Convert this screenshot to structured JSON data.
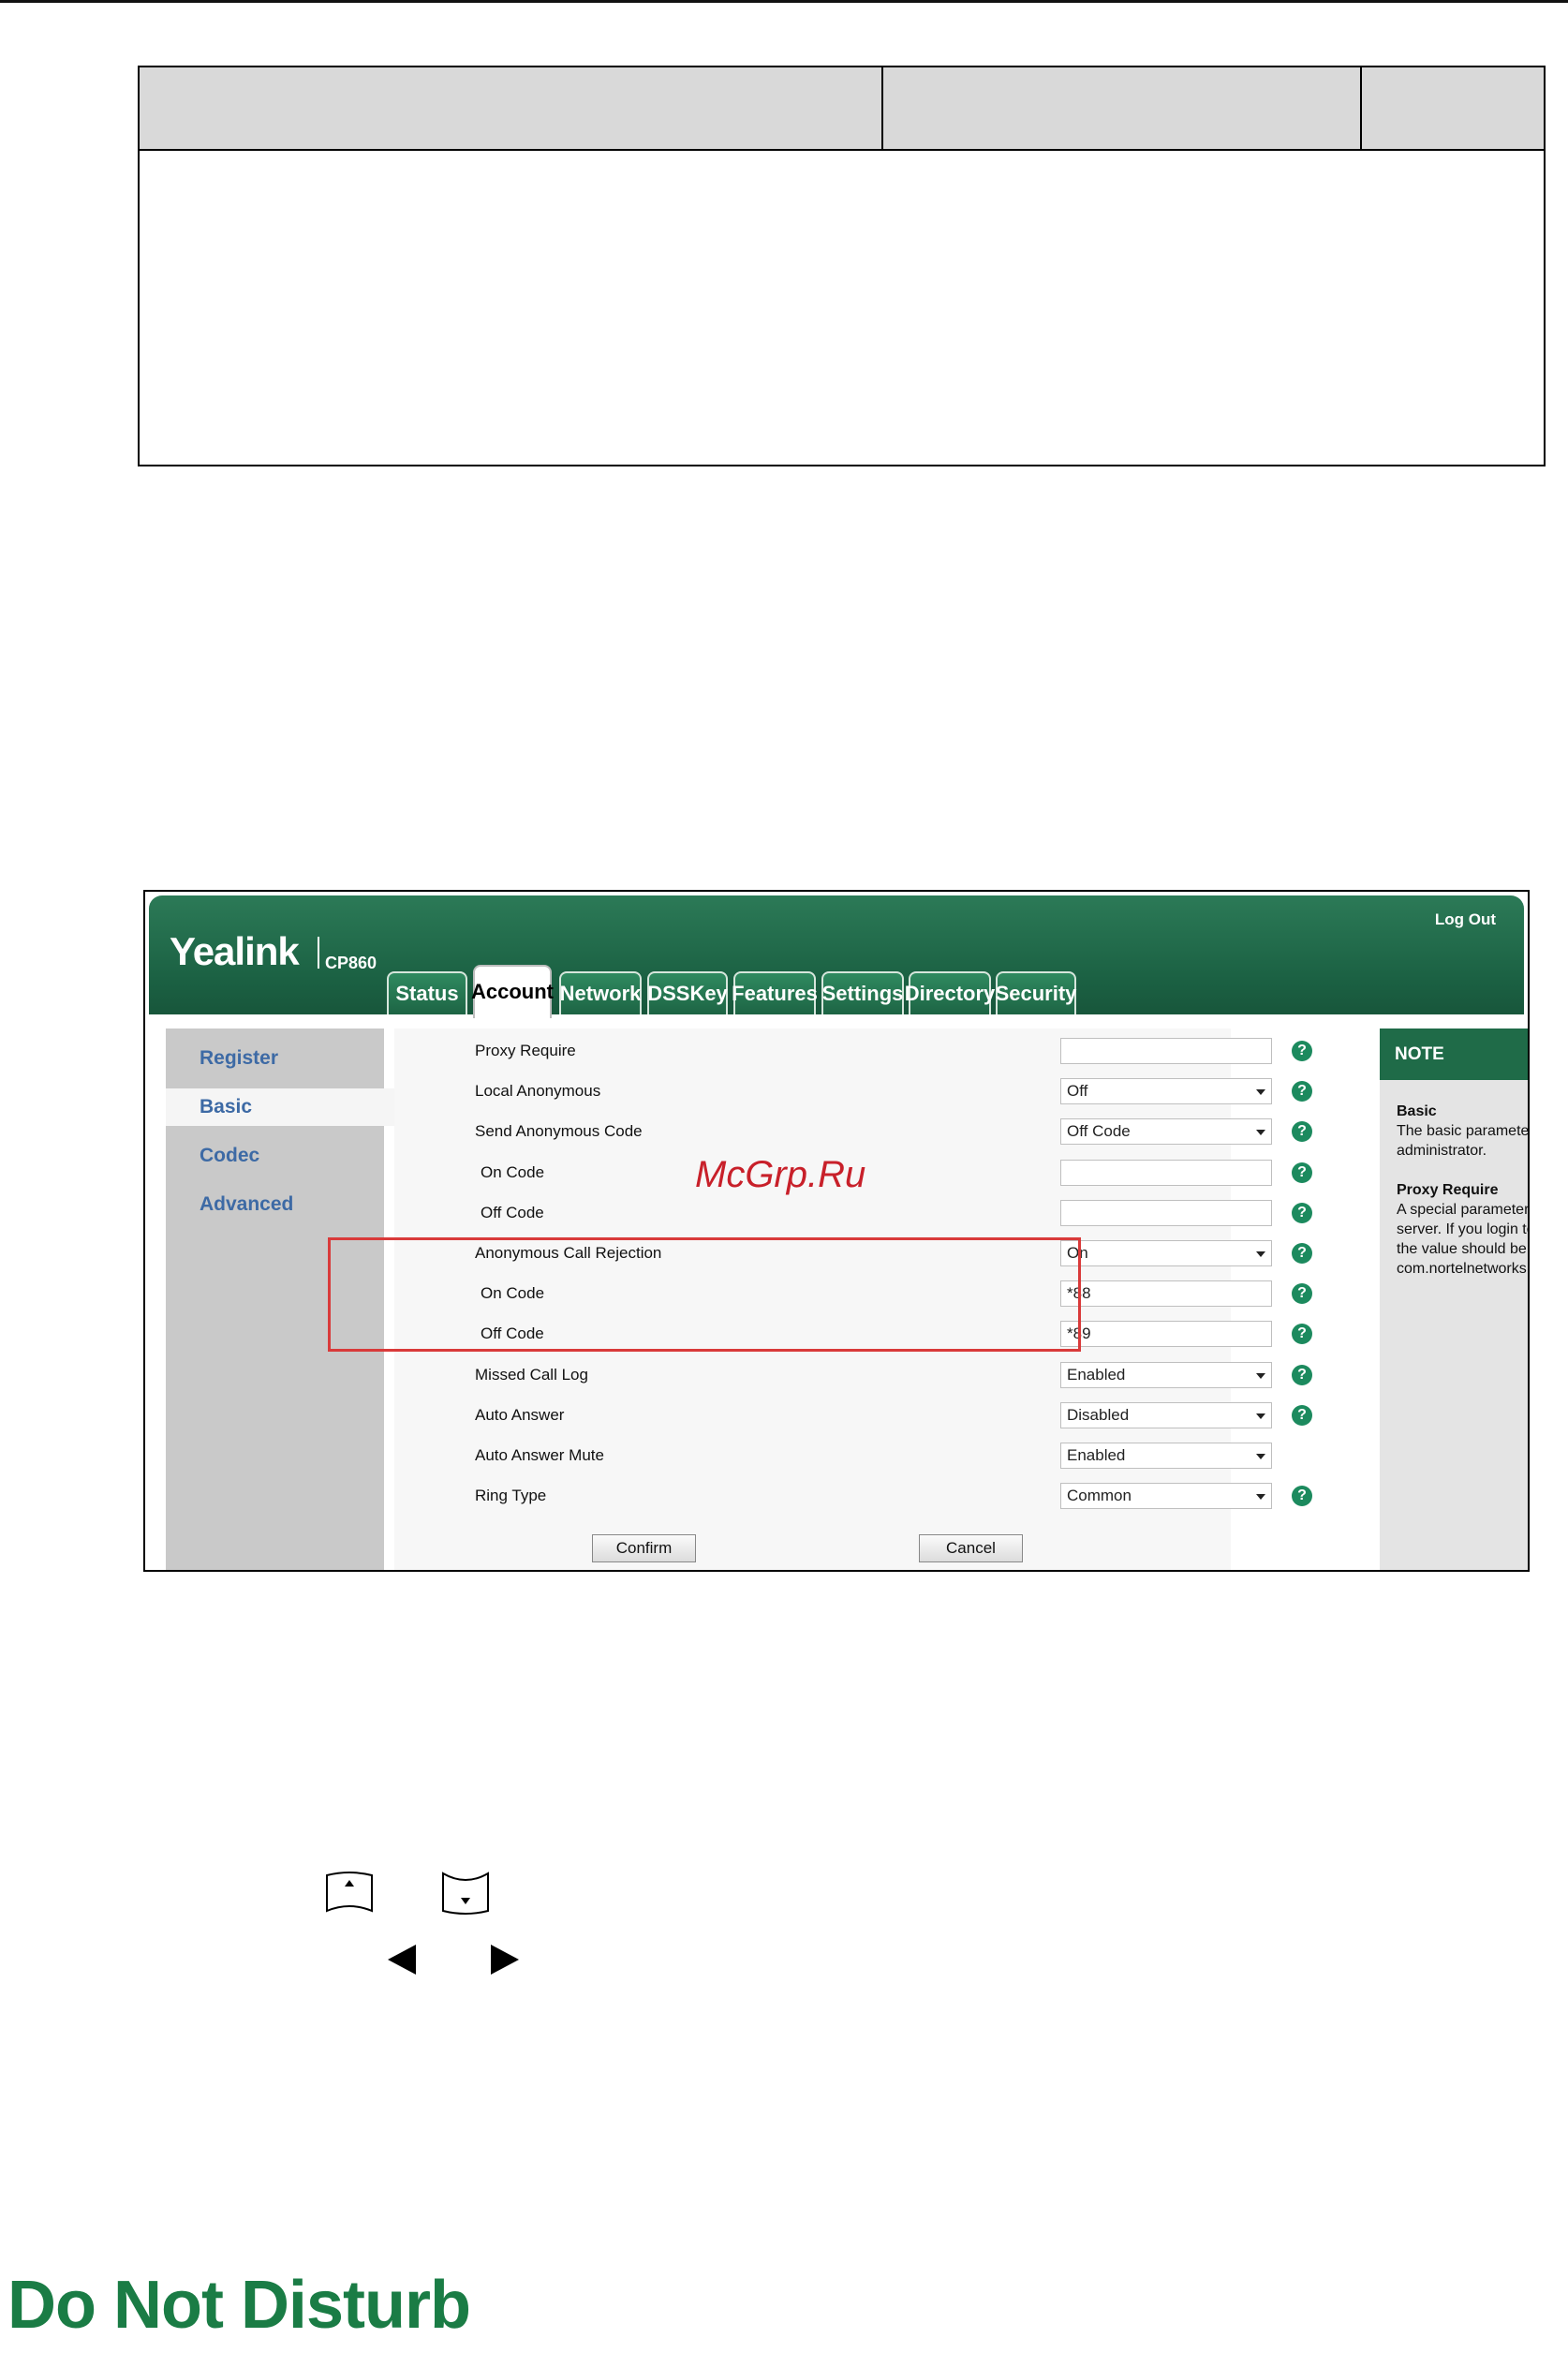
{
  "brand": {
    "logo": "Yealink",
    "model": "CP860",
    "logout": "Log Out"
  },
  "tabs": [
    "Status",
    "Account",
    "Network",
    "DSSKey",
    "Features",
    "Settings",
    "Directory",
    "Security"
  ],
  "active_tab": "Account",
  "sidebar": [
    "Register",
    "Basic",
    "Codec",
    "Advanced"
  ],
  "active_sidebar": "Basic",
  "form": {
    "rows": [
      {
        "label": "Proxy Require",
        "value": "",
        "dropdown": false,
        "help": true
      },
      {
        "label": "Local Anonymous",
        "value": "Off",
        "dropdown": true,
        "help": true
      },
      {
        "label": "Send Anonymous Code",
        "value": "Off Code",
        "dropdown": true,
        "help": true
      },
      {
        "label": "On Code",
        "value": "",
        "dropdown": false,
        "help": true
      },
      {
        "label": "Off Code",
        "value": "",
        "dropdown": false,
        "help": true
      },
      {
        "label": "Anonymous Call Rejection",
        "value": "On",
        "dropdown": true,
        "help": true
      },
      {
        "label": "On Code",
        "value": "*88",
        "dropdown": false,
        "help": true
      },
      {
        "label": "Off Code",
        "value": "*89",
        "dropdown": false,
        "help": true
      },
      {
        "label": "Missed Call Log",
        "value": "Enabled",
        "dropdown": true,
        "help": true
      },
      {
        "label": "Auto Answer",
        "value": "Disabled",
        "dropdown": true,
        "help": true
      },
      {
        "label": "Auto Answer Mute",
        "value": "Enabled",
        "dropdown": true,
        "help": false
      },
      {
        "label": "Ring Type",
        "value": "Common",
        "dropdown": true,
        "help": true
      }
    ],
    "confirm_label": "Confirm",
    "cancel_label": "Cancel",
    "help_glyph": "?"
  },
  "note": {
    "title": "NOTE",
    "basic_title": "Basic",
    "basic_text": "The basic parameters for administrator.",
    "proxy_title": "Proxy Require",
    "proxy_text": "A special parameter just for Nortel server. If you login to Nortel server, the value should be, com.nortelnetworks.firewall"
  },
  "watermark": "McGrp.Ru",
  "section_title": "Do Not Disturb",
  "colors": {
    "banner": "#1b6143",
    "section_title": "#1a7c45",
    "highlight_box": "#d93a3a",
    "note_corner": "#f0822d"
  }
}
